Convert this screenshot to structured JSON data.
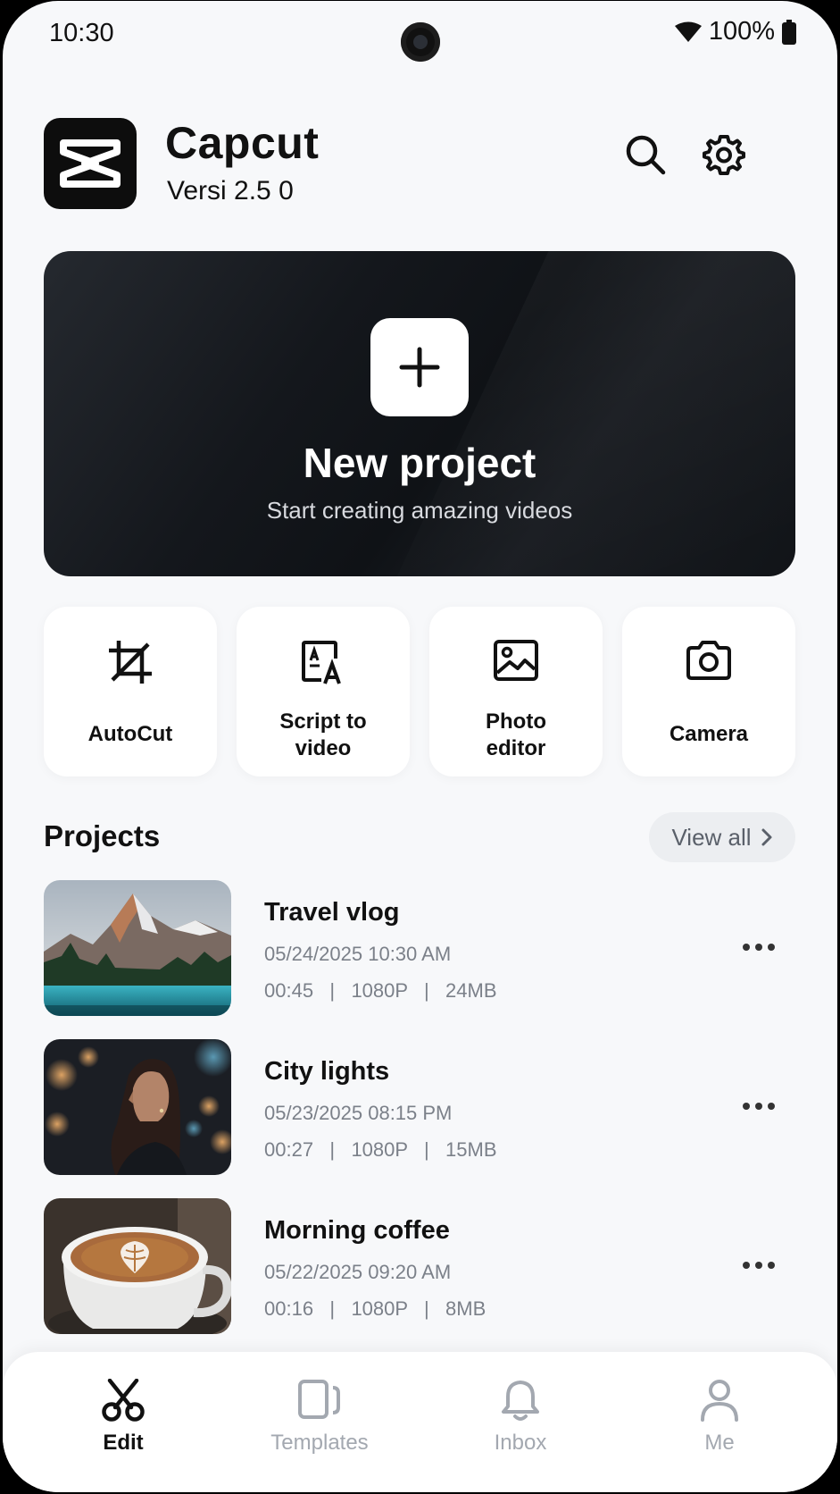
{
  "status_bar": {
    "time": "10:30",
    "battery": "100%"
  },
  "header": {
    "app_name": "Capcut",
    "version": "Versi 2.5 0",
    "icons": [
      "search-icon",
      "gear-icon"
    ]
  },
  "hero": {
    "title": "New project",
    "subtitle": "Start creating amazing videos",
    "icon": "plus-icon",
    "bg_color": "#14171c"
  },
  "tools": [
    {
      "label": "AutoCut",
      "icon": "crop-icon"
    },
    {
      "label": "Script to video",
      "line1": "Script to",
      "line2": "video",
      "icon": "script-text-icon"
    },
    {
      "label": "Photo editor",
      "line1": "Photo",
      "line2": "editor",
      "icon": "image-icon"
    },
    {
      "label": "Camera",
      "icon": "camera-icon"
    }
  ],
  "projects": {
    "title": "Projects",
    "view_all": "View all",
    "items": [
      {
        "name": "Travel vlog",
        "date": "05/24/2025  10:30 AM",
        "duration": "00:45",
        "resolution": "1080P",
        "size": "24MB",
        "meta": "00:45   |   1080P   |   24MB",
        "thumbnail": "mountain-lake"
      },
      {
        "name": "City lights",
        "date": "05/23/2025  08:15 PM",
        "duration": "00:27",
        "resolution": "1080P",
        "size": "15MB",
        "meta": "00:27   |   1080P   |   15MB",
        "thumbnail": "woman-city-night"
      },
      {
        "name": "Morning coffee",
        "date": "05/22/2025  09:20 AM",
        "duration": "00:16",
        "resolution": "1080P",
        "size": "8MB",
        "meta": "00:16   |   1080P   |   8MB",
        "thumbnail": "latte-cup"
      }
    ]
  },
  "bottom_nav": {
    "items": [
      {
        "label": "Edit",
        "icon": "scissors-icon",
        "active": true
      },
      {
        "label": "Templates",
        "icon": "templates-icon",
        "active": false
      },
      {
        "label": "Inbox",
        "icon": "bell-icon",
        "active": false
      },
      {
        "label": "Me",
        "icon": "person-icon",
        "active": false
      }
    ]
  },
  "colors": {
    "background": "#f7f8fa",
    "text_primary": "#111111",
    "text_secondary": "#7b8089",
    "nav_inactive": "#a3a8b0"
  }
}
